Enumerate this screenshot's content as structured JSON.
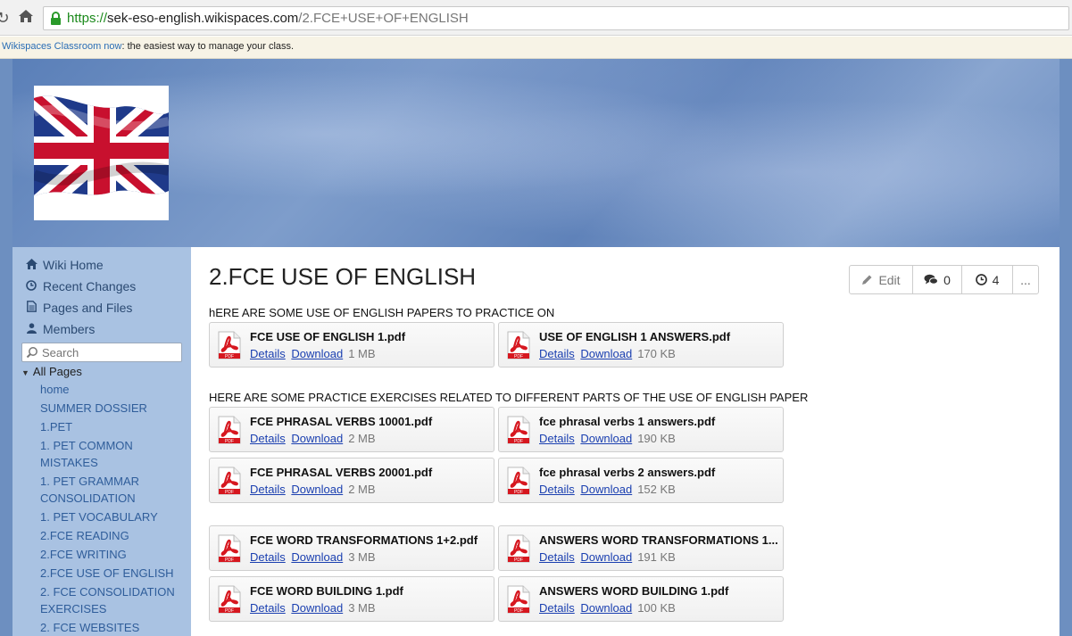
{
  "browser": {
    "url_scheme": "https://",
    "url_host": "sek-eso-english.wikispaces.com",
    "url_path": "/2.FCE+USE+OF+ENGLISH"
  },
  "promo": {
    "link": "Wikispaces Classroom now",
    "text": ": the easiest way to manage your class."
  },
  "sidebar": {
    "nav": [
      {
        "label": "Wiki Home",
        "icon": "home-icon"
      },
      {
        "label": "Recent Changes",
        "icon": "clock-icon"
      },
      {
        "label": "Pages and Files",
        "icon": "document-icon"
      },
      {
        "label": "Members",
        "icon": "user-icon"
      }
    ],
    "search_placeholder": "Search",
    "all_pages_label": "All Pages",
    "pages": [
      "home",
      "SUMMER DOSSIER",
      "1.PET",
      "1. PET COMMON MISTAKES",
      "1. PET GRAMMAR CONSOLIDATION",
      "1. PET VOCABULARY",
      "2.FCE READING",
      "2.FCE WRITING",
      "2.FCE USE OF ENGLISH",
      "2. FCE CONSOLIDATION EXERCISES",
      "2. FCE WEBSITES"
    ]
  },
  "content": {
    "title": "2.FCE USE OF ENGLISH",
    "toolbar": {
      "edit": "Edit",
      "comments": "0",
      "history": "4",
      "more": "..."
    },
    "intro1": "hERE ARE SOME USE OF ENGLISH PAPERS TO PRACTICE ON",
    "intro2": "HERE ARE SOME PRACTICE EXERCISES RELATED TO DIFFERENT PARTS OF THE USE OF ENGLISH PAPER",
    "details_label": "Details",
    "download_label": "Download",
    "files": [
      {
        "name": "FCE USE OF ENGLISH 1.pdf",
        "size": "1 MB"
      },
      {
        "name": "USE OF ENGLISH 1 ANSWERS.pdf",
        "size": "170 KB"
      },
      {
        "name": "FCE PHRASAL VERBS 10001.pdf",
        "size": "2 MB"
      },
      {
        "name": "fce phrasal verbs 1 answers.pdf",
        "size": "190 KB"
      },
      {
        "name": "FCE PHRASAL VERBS 20001.pdf",
        "size": "2 MB"
      },
      {
        "name": "fce phrasal verbs 2 answers.pdf",
        "size": "152 KB"
      },
      {
        "name": "FCE WORD TRANSFORMATIONS 1+2.pdf",
        "size": "3 MB"
      },
      {
        "name": "ANSWERS WORD TRANSFORMATIONS 1...",
        "size": "191 KB"
      },
      {
        "name": "FCE WORD BUILDING 1.pdf",
        "size": "3 MB"
      },
      {
        "name": "ANSWERS WORD BUILDING 1.pdf",
        "size": "100 KB"
      }
    ]
  }
}
